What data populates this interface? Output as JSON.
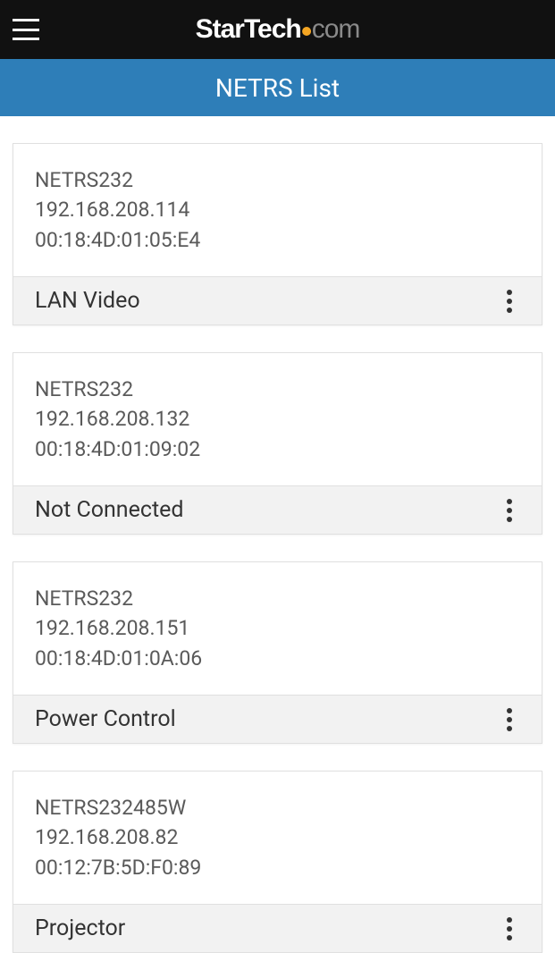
{
  "header": {
    "logo": {
      "part1": "Star",
      "part2": "Tech",
      "part3": "com"
    }
  },
  "titleBar": {
    "title": "NETRS List"
  },
  "devices": [
    {
      "model": "NETRS232",
      "ip": "192.168.208.114",
      "mac": "00:18:4D:01:05:E4",
      "label": "LAN Video"
    },
    {
      "model": "NETRS232",
      "ip": "192.168.208.132",
      "mac": "00:18:4D:01:09:02",
      "label": "Not Connected"
    },
    {
      "model": "NETRS232",
      "ip": "192.168.208.151",
      "mac": "00:18:4D:01:0A:06",
      "label": "Power Control"
    },
    {
      "model": "NETRS232485W",
      "ip": "192.168.208.82",
      "mac": "00:12:7B:5D:F0:89",
      "label": "Projector"
    }
  ]
}
